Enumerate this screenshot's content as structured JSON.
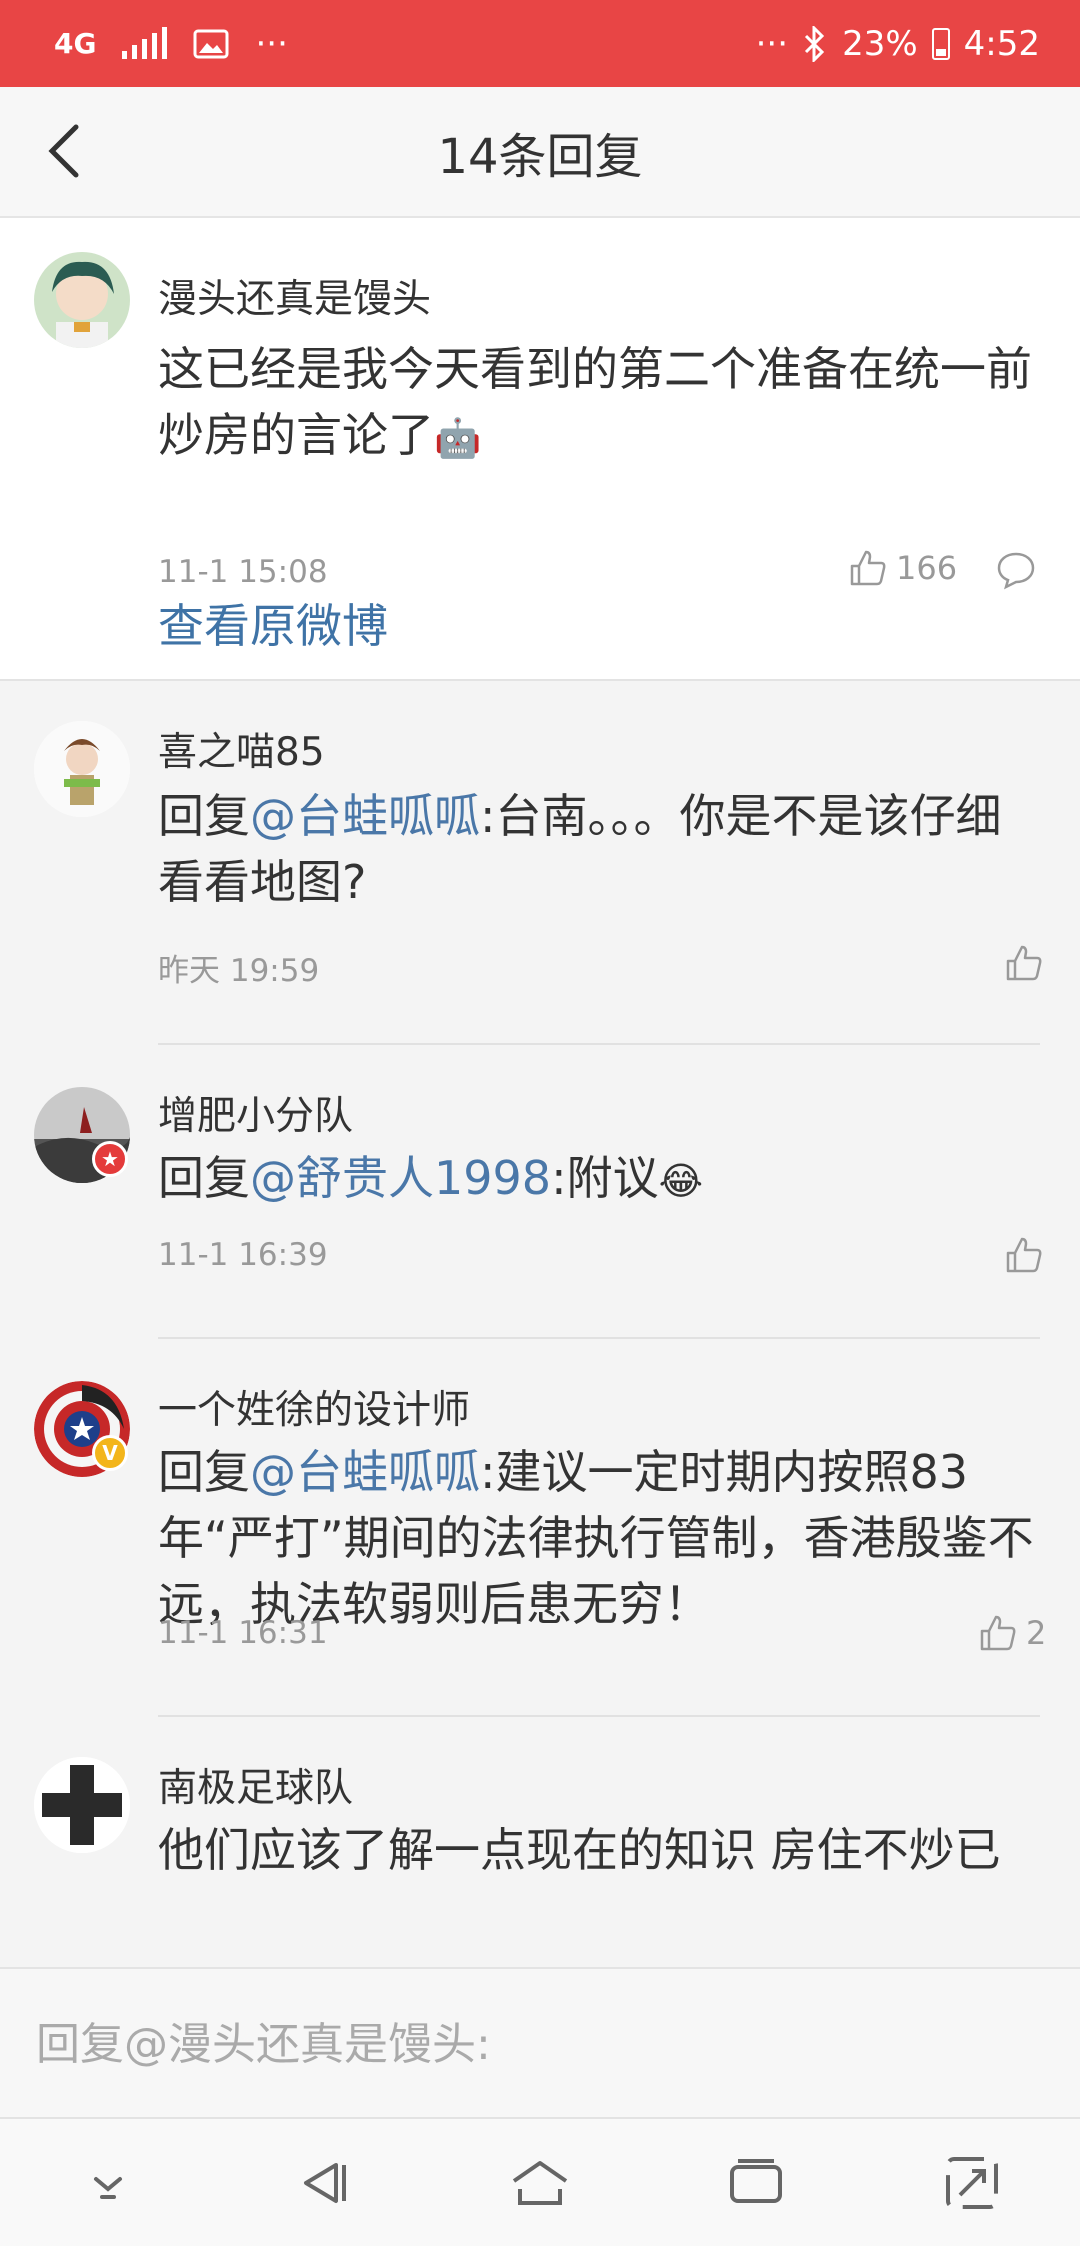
{
  "status_bar": {
    "network": "4G",
    "more_left": "···",
    "more_right": "···",
    "battery_percent": "23%",
    "time": "4:52"
  },
  "header": {
    "title": "14条回复"
  },
  "main_comment": {
    "username": "漫头还真是馒头",
    "text": "这已经是我今天看到的第二个准备在统一前炒房的言论了",
    "emoji": "🤖",
    "time": "11-1 15:08",
    "likes": "166",
    "view_original": "查看原微博"
  },
  "replies": [
    {
      "username": "喜之喵85",
      "prefix": "回复",
      "mention": "@台蛙呱呱",
      "text": ":台南。。。你是不是该仔细看看地图?",
      "time": "昨天 19:59",
      "likes": ""
    },
    {
      "username": "增肥小分队",
      "prefix": "回复",
      "mention": "@舒贵人1998",
      "text": ":附议",
      "emoji": "😂",
      "time": "11-1 16:39",
      "likes": "",
      "badge": "★"
    },
    {
      "username": "一个姓徐的设计师",
      "prefix": "回复",
      "mention": "@台蛙呱呱",
      "text": ":建议一定时期内按照83年“严打”期间的法律执行管制，香港殷鉴不远，执法软弱则后患无穷！",
      "time": "11-1 16:31",
      "likes": "2",
      "badge": "V"
    },
    {
      "username": "南极足球队",
      "prefix": "",
      "mention": "",
      "text": "他们应该了解一点现在的知识 房住不炒已",
      "time": "",
      "likes": ""
    }
  ],
  "input": {
    "placeholder": "回复@漫头还真是馒头:"
  },
  "colors": {
    "status_bar": "#e84545",
    "link": "#4a77a8"
  }
}
